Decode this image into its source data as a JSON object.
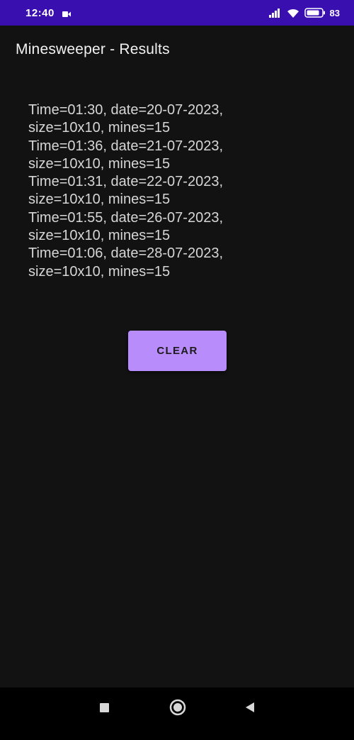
{
  "status_bar": {
    "time": "12:40",
    "battery_percent": "83",
    "icons": [
      "video-icon",
      "signal-icon",
      "wifi-icon",
      "battery-icon"
    ]
  },
  "app_bar": {
    "title": "Minesweeper - Results"
  },
  "results": [
    "Time=01:30, date=20-07-2023,",
    "size=10x10, mines=15",
    "Time=01:36, date=21-07-2023,",
    "size=10x10, mines=15",
    "Time=01:31, date=22-07-2023,",
    "size=10x10, mines=15",
    "Time=01:55, date=26-07-2023,",
    "size=10x10, mines=15",
    "Time=01:06, date=28-07-2023,",
    "size=10x10, mines=15"
  ],
  "actions": {
    "clear_label": "CLEAR"
  },
  "colors": {
    "status_bar": "#3a0fb0",
    "background": "#121212",
    "button": "#b98cfc",
    "text": "#d6d6d6"
  },
  "nav_bar": {
    "icons": [
      "recent-apps-icon",
      "home-icon",
      "back-icon"
    ]
  }
}
